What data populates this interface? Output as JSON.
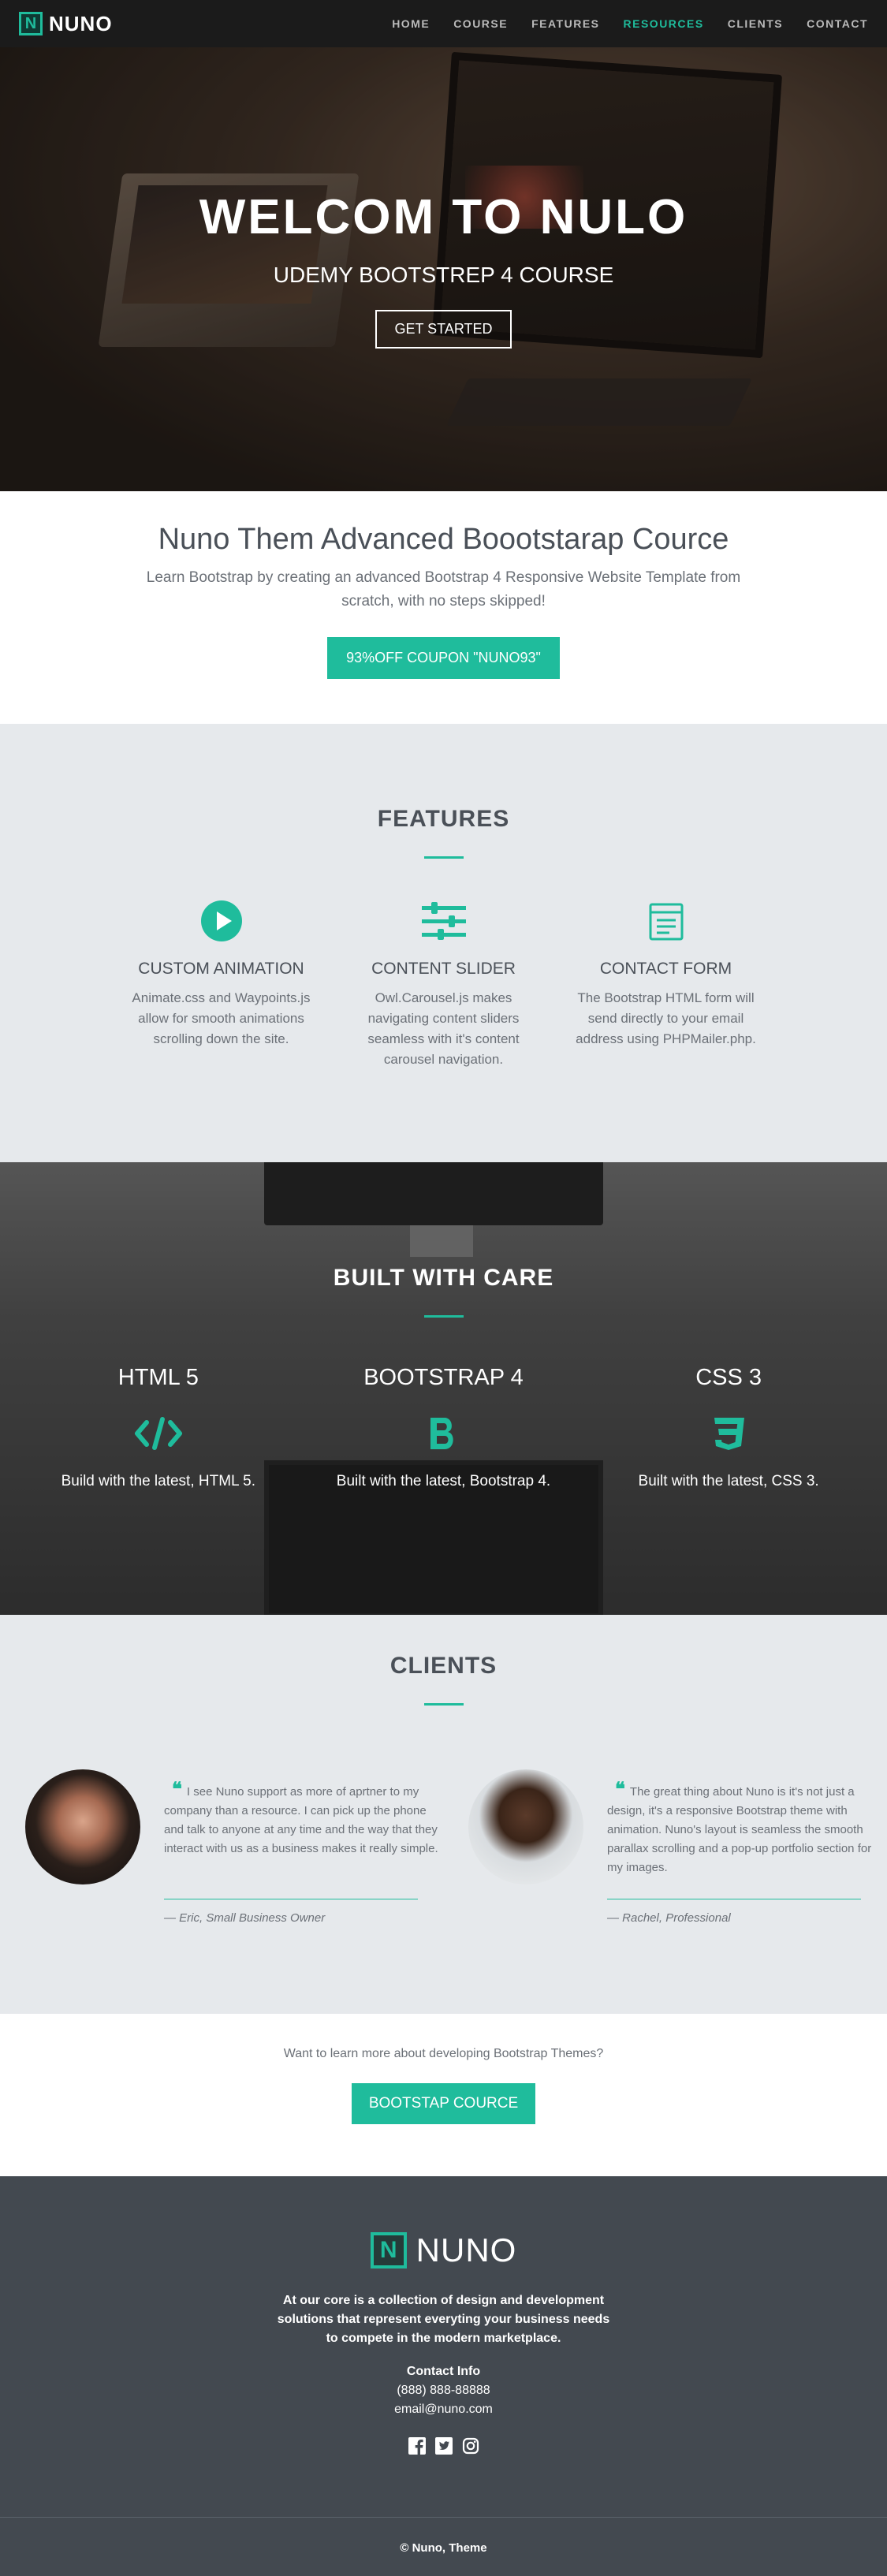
{
  "nav": {
    "brand_letter": "N",
    "brand": "NUNO",
    "items": [
      {
        "label": "HOME",
        "active": false
      },
      {
        "label": "COURSE",
        "active": false
      },
      {
        "label": "FEATURES",
        "active": false
      },
      {
        "label": "RESOURCES",
        "active": true
      },
      {
        "label": "CLIENTS",
        "active": false
      },
      {
        "label": "CONTACT",
        "active": false
      }
    ]
  },
  "hero": {
    "title": "WELCOM TO NULO",
    "subtitle": "UDEMY BOOTSTREP 4 COURSE",
    "button": "GET STARTED"
  },
  "intro": {
    "title": "Nuno Them Advanced Boootstarap Cource",
    "text": "Learn Bootstrap by creating an advanced Bootstrap 4 Responsive Website Template from scratch, with no steps skipped!",
    "button": "93%OFF COUPON \"NUNO93\""
  },
  "features": {
    "title": "FEATURES",
    "items": [
      {
        "icon": "play-circle-icon",
        "title": "CUSTOM ANIMATION",
        "text": "Animate.css and Waypoints.js allow for smooth animations scrolling down the site."
      },
      {
        "icon": "sliders-icon",
        "title": "CONTENT SLIDER",
        "text": "Owl.Carousel.js makes navigating content sliders seamless with it's content carousel navigation."
      },
      {
        "icon": "form-icon",
        "title": "CONTACT FORM",
        "text": "The Bootstrap HTML form will send directly to your email address using PHPMailer.php."
      }
    ]
  },
  "built": {
    "title": "BUILT WITH CARE",
    "items": [
      {
        "title": "HTML 5",
        "icon": "code-icon",
        "text": "Build with the latest, HTML 5."
      },
      {
        "title": "BOOTSTRAP 4",
        "icon": "bootstrap-icon",
        "text": "Built with the latest, Bootstrap 4."
      },
      {
        "title": "CSS 3",
        "icon": "css3-icon",
        "text": "Built with the latest, CSS 3."
      }
    ]
  },
  "clients": {
    "title": "CLIENTS",
    "testimonials": [
      {
        "quote": "I see Nuno support as more of aprtner to my company than a resource. I can pick up the phone and talk to anyone at any time and the way that they interact with us as a business makes it really simple.",
        "author": "— Eric, Small Business Owner"
      },
      {
        "quote": "The great thing about Nuno is it's not just a design, it's a responsive Bootstrap theme with animation. Nuno's layout is seamless the smooth parallax scrolling and a pop-up portfolio section for my images.",
        "author": "— Rachel, Professional"
      }
    ]
  },
  "cta": {
    "text": "Want to learn more about developing Bootstrap Themes?",
    "button": "BOOTSTAP COURCE"
  },
  "footer": {
    "brand_letter": "N",
    "brand": "NUNO",
    "about": "At our core is a collection of design and development solutions that represent everyting your business needs to compete in the modern marketplace.",
    "contact_title": "Contact Info",
    "phone": "(888) 888-88888",
    "email": "email@nuno.com",
    "social": [
      "facebook-icon",
      "twitter-icon",
      "instagram-icon"
    ],
    "copyright": "© Nuno, Theme"
  },
  "colors": {
    "accent": "#1fbc9c",
    "dark": "#434950",
    "light_bg": "#e6e9ec"
  }
}
